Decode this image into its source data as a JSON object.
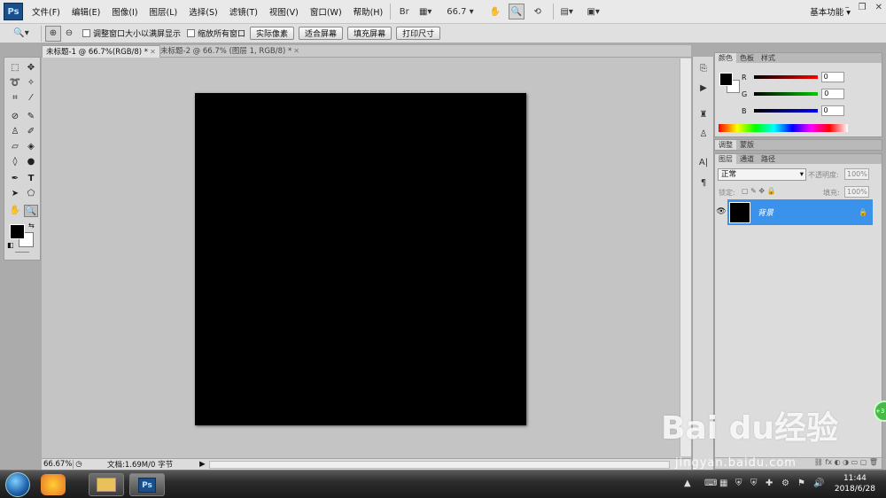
{
  "app": {
    "logo": "Ps",
    "workspace": "基本功能 ▾"
  },
  "menu": [
    "文件(F)",
    "编辑(E)",
    "图像(I)",
    "图层(L)",
    "选择(S)",
    "滤镜(T)",
    "视图(V)",
    "窗口(W)",
    "帮助(H)"
  ],
  "toolbar": {
    "zoom_level": "66.7 ▾"
  },
  "options": {
    "resize_windows": "调整窗口大小以满屏显示",
    "zoom_all": "缩放所有窗口",
    "actual_pixels": "实际像素",
    "fit_screen": "适合屏幕",
    "fill_screen": "填充屏幕",
    "print_size": "打印尺寸"
  },
  "tabs": [
    {
      "label": "未标题-1 @ 66.7%(RGB/8) *"
    },
    {
      "label": "未标题-2 @ 66.7% (图层 1, RGB/8) *"
    }
  ],
  "status": {
    "zoom": "66.67%",
    "doc": "文档:1.69M/0 字节"
  },
  "color_panel": {
    "tabs": [
      "颜色",
      "色板",
      "样式"
    ],
    "r_label": "R",
    "g_label": "G",
    "b_label": "B",
    "r": "0",
    "g": "0",
    "b": "0"
  },
  "adjust_panel": {
    "tabs": [
      "调整",
      "蒙版"
    ]
  },
  "layers_panel": {
    "tabs": [
      "图层",
      "通道",
      "路径"
    ],
    "blend_mode": "正常",
    "opacity_label": "不透明度:",
    "opacity": "100%",
    "lock_label": "锁定:",
    "fill_label": "填充:",
    "fill": "100%",
    "layer_name": "背景"
  },
  "taskbar": {
    "time": "11:44",
    "date": "2018/6/28"
  },
  "watermark": {
    "brand": "Bai du经验",
    "url": "jingyan.baidu.com"
  },
  "colors": {
    "layer_selected": "#3b92ea",
    "canvas": "#000000"
  }
}
